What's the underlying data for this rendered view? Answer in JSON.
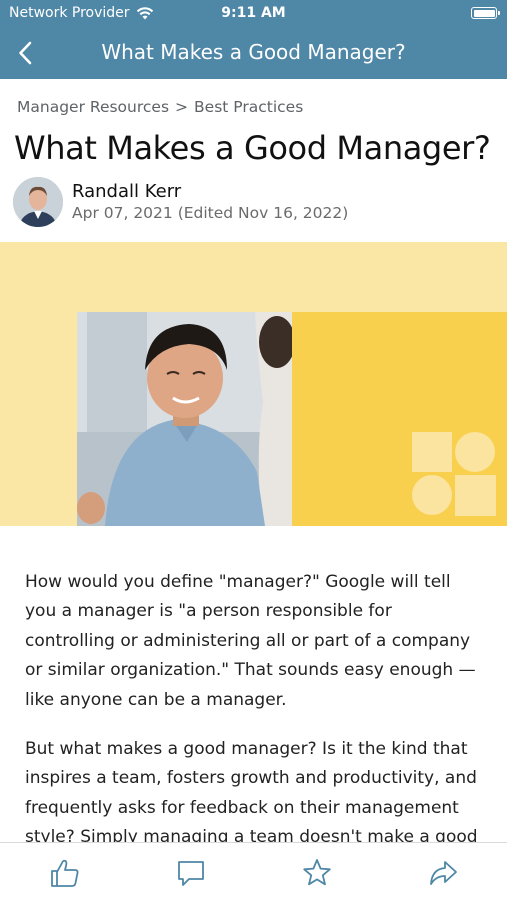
{
  "status_bar": {
    "carrier": "Network Provider",
    "time": "9:11 AM",
    "wifi_icon": "wifi-icon",
    "battery_icon": "battery-icon"
  },
  "nav": {
    "title": "What Makes a Good Manager?",
    "back_icon": "chevron-left-icon"
  },
  "breadcrumb": {
    "items": [
      "Manager Resources",
      "Best Practices"
    ],
    "separator": ">"
  },
  "article": {
    "title": "What Makes a Good Manager?",
    "author": "Randall Kerr",
    "date": "Apr 07, 2021 (Edited Nov 16, 2022)",
    "paragraphs": [
      "How would you define \"manager?\" Google will tell you a manager is \"a person responsible for controlling or administering all or part of a company or similar organization.\" That sounds easy enough — like anyone can be a manager.",
      "But what makes a good manager? Is it the kind that inspires a team, fosters growth and productivity, and frequently asks for feedback on their management style? Simply managing a team doesn't make a good"
    ]
  },
  "toolbar": {
    "items": [
      "thumbs-up-icon",
      "comment-icon",
      "star-icon",
      "share-icon"
    ]
  },
  "colors": {
    "header_bg": "#4f87a6",
    "hero_light_yellow": "#fbe7a5",
    "hero_yellow": "#f9d04d",
    "hero_shape": "#fbe3a0"
  }
}
